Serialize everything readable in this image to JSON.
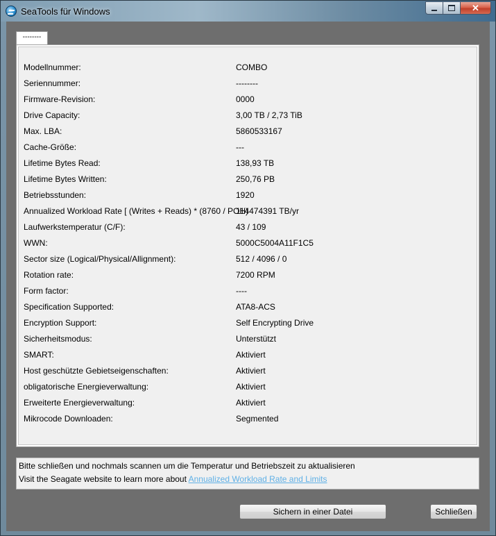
{
  "window": {
    "title": "SeaTools für Windows",
    "icon": "seatools-logo-icon",
    "controls": [
      "minimize-icon",
      "maximize-icon",
      "close-icon"
    ]
  },
  "tab": {
    "label": "--------"
  },
  "properties": [
    {
      "label": "Modellnummer:",
      "value": "COMBO"
    },
    {
      "label": "Seriennummer:",
      "value": "--------"
    },
    {
      "label": "Firmware-Revision:",
      "value": "0000"
    },
    {
      "label": "Drive Capacity:",
      "value": "3,00 TB / 2,73 TiB"
    },
    {
      "label": "Max. LBA:",
      "value": "5860533167"
    },
    {
      "label": "Cache-Größe:",
      "value": "---"
    },
    {
      "label": "Lifetime Bytes Read:",
      "value": "138,93  TB"
    },
    {
      "label": "Lifetime Bytes Written:",
      "value": "250,76  PB"
    },
    {
      "label": "Betriebsstunden:",
      "value": "1920"
    },
    {
      "label": "Annualized Workload Rate [ (Writes + Reads) * (8760 / POH)",
      "value": "114474391 TB/yr"
    },
    {
      "label": "Laufwerkstemperatur (C/F):",
      "value": "43 / 109"
    },
    {
      "label": "WWN:",
      "value": "5000C5004A11F1C5"
    },
    {
      "label": "Sector size (Logical/Physical/Allignment):",
      "value": "512 / 4096 / 0"
    },
    {
      "label": "Rotation rate:",
      "value": "7200 RPM"
    },
    {
      "label": "Form factor:",
      "value": "----"
    },
    {
      "label": "Specification Supported:",
      "value": "ATA8-ACS"
    },
    {
      "label": "Encryption Support:",
      "value": "Self Encrypting Drive"
    },
    {
      "label": "Sicherheitsmodus:",
      "value": "Unterstützt"
    },
    {
      "label": "SMART:",
      "value": "Aktiviert"
    },
    {
      "label": "Host geschützte Gebietseigenschaften:",
      "value": "Aktiviert"
    },
    {
      "label": "obligatorische Energieverwaltung:",
      "value": "Aktiviert"
    },
    {
      "label": "Erweiterte Energieverwaltung:",
      "value": "Aktiviert"
    },
    {
      "label": "Mikrocode  Downloaden:",
      "value": "Segmented"
    }
  ],
  "info": {
    "line1": "Bitte schließen und nochmals scannen um die Temperatur und Betriebszeit zu aktualisieren",
    "line2_prefix": "Visit the Seagate website to learn more about ",
    "line2_link": "Annualized Workload Rate and Limits"
  },
  "buttons": {
    "save": "Sichern in einer Datei",
    "close": "Schließen"
  },
  "colors": {
    "link": "#5fb0e6",
    "close_button": "#c0402a"
  }
}
